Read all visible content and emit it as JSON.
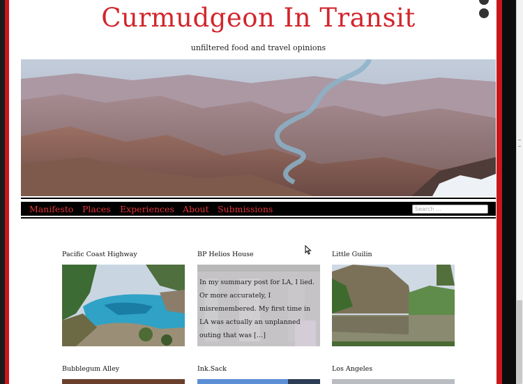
{
  "site": {
    "title": "Curmudgeon In Transit",
    "tagline": "unfiltered food and travel opinions"
  },
  "nav": {
    "items": [
      "Manifesto",
      "Places",
      "Experiences",
      "About",
      "Submissions"
    ],
    "search_placeholder": "Search ..."
  },
  "posts": [
    {
      "title": "Pacific Coast Highway"
    },
    {
      "title": "BP Helios House",
      "excerpt": "In my summary post for LA, I lied. Or more accurately, I misremembered. My first time in LA was actually an unplanned outing that was […]"
    },
    {
      "title": "Little Guilin"
    },
    {
      "title": "Bubblegum Alley"
    },
    {
      "title": "Ink.Sack"
    },
    {
      "title": "Los Angeles"
    }
  ],
  "colors": {
    "accent": "#d2262c",
    "nav_bg": "#000000",
    "frame_red": "#c8161d"
  }
}
